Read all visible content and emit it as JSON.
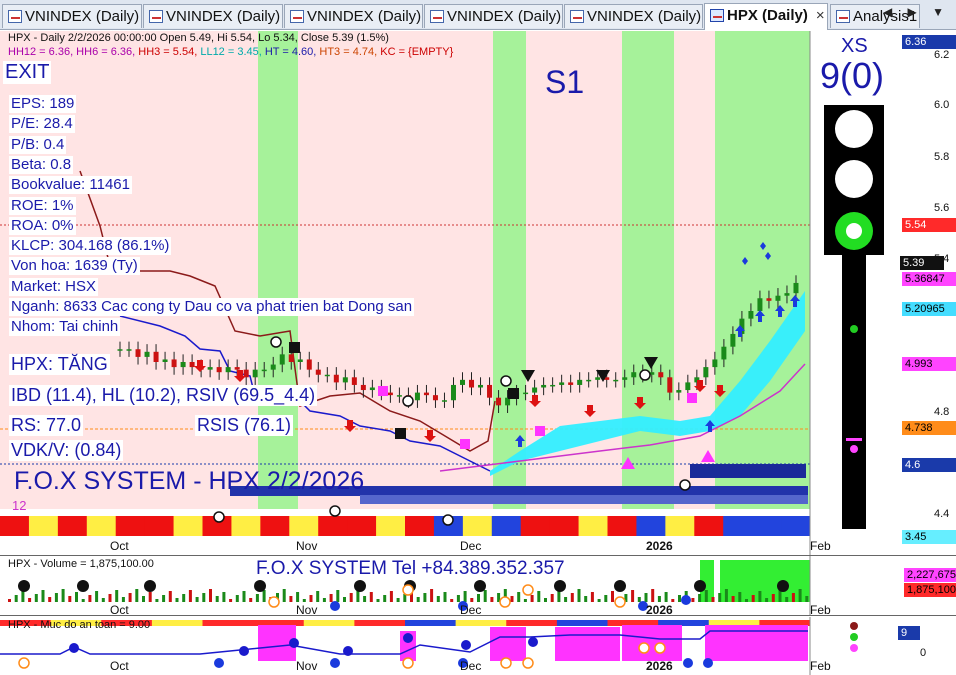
{
  "tabs": [
    {
      "label": "VNINDEX (Daily)",
      "active": false
    },
    {
      "label": "VNINDEX (Daily)",
      "active": false
    },
    {
      "label": "VNINDEX (Daily)",
      "active": false
    },
    {
      "label": "VNINDEX (Daily)",
      "active": false
    },
    {
      "label": "VNINDEX (Daily)",
      "active": false
    },
    {
      "label": "HPX (Daily)",
      "active": true
    },
    {
      "label": "Analysis1",
      "active": false
    }
  ],
  "tab_close": "×",
  "nav_arrows": "◀ ▶ ▼",
  "main": {
    "title_line": "HPX - Daily 2/2/2026 00:00:00 Open 5.49, Hi 5.54, Lo 5.34, Close 5.39 (1.5%)",
    "hh_line": [
      {
        "text": "HH12 = 6.36, HH6 = 6.36, ",
        "color": "#aa00aa"
      },
      {
        "text": "HH3 = 5.54, ",
        "color": "#cc0000"
      },
      {
        "text": "LL12 = 3.45, ",
        "color": "#00aaaa"
      },
      {
        "text": "HT = 4.60, ",
        "color": "#1a1aaa"
      },
      {
        "text": "HT3 = 4.74, ",
        "color": "#cc4400"
      },
      {
        "text": "KC = {EMPTY}",
        "color": "#cc0000"
      }
    ],
    "exit_label": "EXIT",
    "info": [
      "EPS: 189",
      "P/E: 28.4",
      "P/B: 0.4",
      "Beta: 0.8",
      "Bookvalue: 11461",
      "ROE: 1%",
      "ROA: 0%",
      "KLCP: 304.168 (86.1%)",
      "Von hoa: 1639 (Ty)",
      "Market: HSX",
      "Nganh: 8633 Cac cong ty Dau co va phat trien bat Dong san",
      "Nhom: Tai chinh"
    ],
    "trend_label": "HPX: TĂNG",
    "ibd_label": "IBD (11.4), HL (10.2), RSIV (69.5_4.4)",
    "rs_label": "RS: 77.0",
    "rsis_label": "RSIS (76.1)",
    "vdk_label": "VDK/V:  (0.84)",
    "system_label": "F.O.X SYSTEM - HPX 2/2/2026",
    "num_12": "12",
    "s1_label": "S1",
    "xs_label": "XS",
    "xs_value": "9(0)",
    "y_axis": [
      "6.2",
      "6.0",
      "5.8",
      "5.6",
      "5.4",
      "5.2",
      "4.8",
      "4.6",
      "4.4"
    ],
    "price_tags": [
      {
        "text": "6.36",
        "bg": "#1a3aaa",
        "fg": "#ffffff"
      },
      {
        "text": "5.54",
        "bg": "#ff2a2a",
        "fg": "#ffffff"
      },
      {
        "text": "5.39",
        "bg": "#111111",
        "fg": "#ffffff"
      },
      {
        "text": "5.36847",
        "bg": "#ff44ff",
        "fg": "#000000"
      },
      {
        "text": "5.20965",
        "bg": "#44ddff",
        "fg": "#000000"
      },
      {
        "text": "4.993",
        "bg": "#ff44ff",
        "fg": "#000000"
      },
      {
        "text": "4.738",
        "bg": "#ff8c1a",
        "fg": "#000000"
      },
      {
        "text": "4.6",
        "bg": "#1a3aaa",
        "fg": "#ffffff"
      },
      {
        "text": "3.45",
        "bg": "#66eeff",
        "fg": "#000000"
      }
    ],
    "months": [
      "Oct",
      "Nov",
      "Dec",
      "2026",
      "Feb"
    ]
  },
  "volume": {
    "title": "HPX - Volume = 1,875,100.00",
    "tel_label": "F.O.X SYSTEM Tel +84.389.352.357",
    "tags": [
      {
        "text": "2,227,675",
        "bg": "#ff44ff",
        "fg": "#000000"
      },
      {
        "text": "1,875,100",
        "bg": "#ff2a2a",
        "fg": "#000000"
      }
    ],
    "months": [
      "Oct",
      "Nov",
      "Dec",
      "2026",
      "Feb"
    ]
  },
  "safety": {
    "title": "HPX - Muc do an toan = 9.00",
    "axis": [
      "0"
    ],
    "tag": {
      "text": "9",
      "bg": "#1a3aaa",
      "fg": "#ffffff"
    },
    "months": [
      "Oct",
      "Nov",
      "Dec",
      "2026",
      "Feb"
    ]
  },
  "colors": {
    "pink_bg": "#ffe4e4",
    "green_bg": "#a6f29a",
    "text_blue": "#1a1aaa",
    "up_candle": "#1a8a1a",
    "down_candle": "#cc1111",
    "cyan": "#33eeff",
    "magenta": "#ff33ff"
  }
}
